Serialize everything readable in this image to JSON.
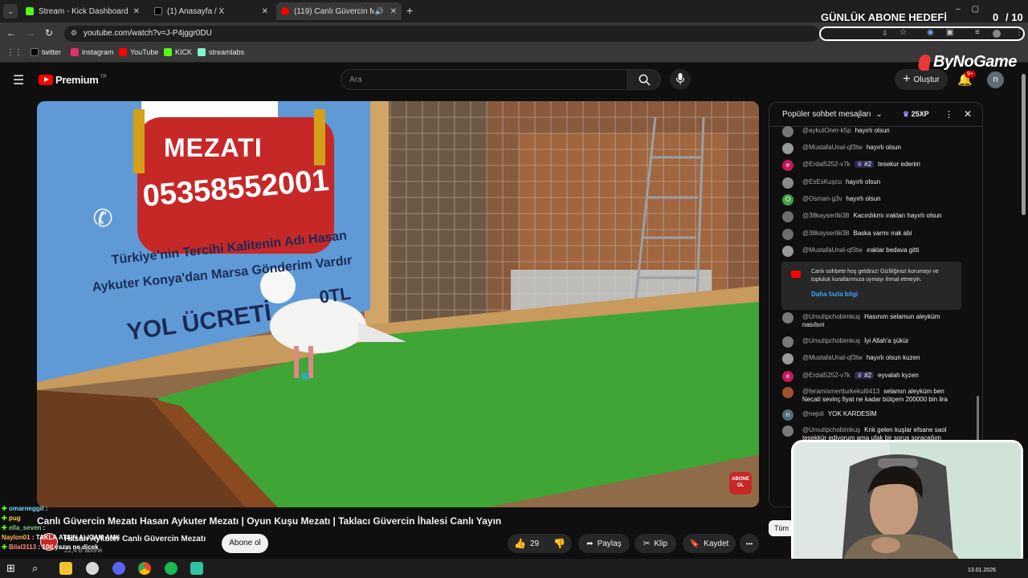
{
  "browser": {
    "tabs": [
      {
        "title": "Stream - Kick Dashboard",
        "color": "#53fc18"
      },
      {
        "title": "(1) Anasayfa / X",
        "color": "#000000"
      },
      {
        "title": "(119) Canlı Güvercin Mezatı",
        "color": "#ff0000"
      }
    ],
    "new_tab_label": "+",
    "url": "youtube.com/watch?v=J-P4jggr0DU"
  },
  "bookmarks": [
    {
      "label": "twitter",
      "color": "#000000"
    },
    {
      "label": "instagram",
      "color": "#e1306c"
    },
    {
      "label": "YouTube",
      "color": "#ff0000"
    },
    {
      "label": "KICK",
      "color": "#53fc18"
    },
    {
      "label": "streamlabs",
      "color": "#80f5d2"
    }
  ],
  "overlay": {
    "goal_title": "GÜNLÜK ABONE HEDEFİ",
    "goal_count": "0",
    "goal_target": "/ 10",
    "brand": "ByNoGame",
    "date": "13.01.2026",
    "kick_chat": [
      {
        "user": "omarneggit",
        "text": ""
      },
      {
        "user": "pug",
        "text": ""
      },
      {
        "user": "ella_seven",
        "text": ""
      },
      {
        "user": "Naylon01",
        "text": "TAKLA ATSIN ALICAM AMK"
      },
      {
        "user": "Bilal3113",
        "text": "10tl yazın ne dicek"
      }
    ]
  },
  "youtube": {
    "logo_text": "Premium",
    "logo_region": "TR",
    "search_placeholder": "Ara",
    "create_label": "Oluştur",
    "notif_count": "9+",
    "avatar_letter": "n"
  },
  "video": {
    "sign_line1": "MEZATI",
    "sign_phone": "05358552001",
    "sign_line2": "Türkiye'nin Tercihi Kalitenin Adı Hasan",
    "sign_line3": "Aykuter Konya'dan Marsa Gönderim Vardır",
    "sign_line4": "YOL ÜCRETİ",
    "sign_line4b": "0TL",
    "subscribe_badge1": "ABONE",
    "subscribe_badge2": "OL"
  },
  "below_video": {
    "title": "Canlı Güvercin Mezatı Hasan Aykuter Mezatı | Oyun Kuşu Mezatı | Taklacı Güvercin İhalesi Canlı Yayın",
    "channel": "Hasan Aykuter Canlı Güvercin Mezatı",
    "subscribers": "22,4 B abone",
    "subscribe_btn": "Abone ol",
    "likes": "29",
    "share": "Paylaş",
    "clip": "Klip",
    "save": "Kaydet",
    "more": "•••",
    "side_tab": "Tüm"
  },
  "chat": {
    "header": "Popüler sohbet mesajları",
    "xp": "25XP",
    "messages": [
      {
        "author": "@aykutOner-k5p",
        "text": "hayırlı olsun",
        "avatar": "",
        "color": "#777777"
      },
      {
        "author": "@MustafaUnal-qf3tw",
        "text": "hayırlı olsun",
        "avatar": "",
        "color": "#9a9a9a"
      },
      {
        "author": "@Erdal5252-v7k",
        "badge": "#2",
        "text": "tesekur ederim",
        "avatar": "e",
        "color": "#c2185b"
      },
      {
        "author": "@EsEsKuşcu",
        "text": "hayırlı olsun",
        "avatar": "",
        "color": "#8a8a8a"
      },
      {
        "author": "@Osman-g3v",
        "text": "hayırlı olsun",
        "avatar": "O",
        "color": "#43a047"
      },
      {
        "author": "@38kayseriliii38",
        "text": "Kacırdıkmı ırakları hayırlı olsun",
        "avatar": "",
        "color": "#6d6d6d"
      },
      {
        "author": "@38kayseriliii38",
        "text": "Baska varmı ırak abi",
        "avatar": "",
        "color": "#6d6d6d"
      },
      {
        "author": "@MustafaUnal-qf3tw",
        "text": "ıraklar bedava gitti",
        "avatar": "",
        "color": "#9a9a9a"
      },
      {
        "author": "@Umuttpchobimkuş",
        "text": "Hasınım selamun aleyküm nasılsın",
        "avatar": "",
        "color": "#7a7a7a"
      },
      {
        "author": "@Umuttpchobimkuş",
        "text": "İyi Allah'a şükür",
        "avatar": "",
        "color": "#7a7a7a"
      },
      {
        "author": "@MustafaUnal-qf3tw",
        "text": "hayırlı olsun kuzen",
        "avatar": "",
        "color": "#9a9a9a"
      },
      {
        "author": "@Erdal5252-v7k",
        "badge": "#2",
        "text": "eyvalah kyzen",
        "avatar": "e",
        "color": "#c2185b"
      },
      {
        "author": "@feramismertturkekul6413",
        "text": "selamın aleyküm ben Necati sevinç fiyat ne kadar bütçem 200000 bin lira",
        "avatar": "",
        "color": "#a0522d"
      },
      {
        "author": "@nejoli",
        "text": "YOK KARDESİM",
        "avatar": "n",
        "color": "#546e7a"
      },
      {
        "author": "@Umuttpchobimkuş",
        "text": "Knk gelen kuşlar efsane saol teşekkür ediyorum ama ufak bir soruş soracağım",
        "avatar": "",
        "color": "#7a7a7a"
      }
    ],
    "notice_text": "Canlı sohbete hoş geldiniz! Gizliliğinizi korumayı ve topluluk kurallarımıza uymayı ihmal etmeyin.",
    "notice_link": "Daha fazla bilgi"
  }
}
